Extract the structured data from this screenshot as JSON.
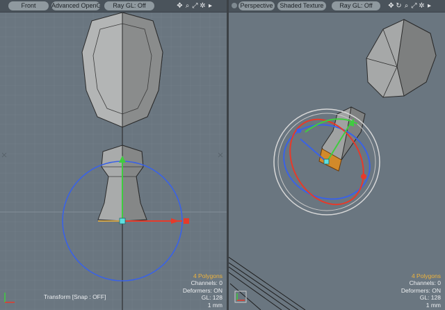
{
  "left_viewport": {
    "view_label": "Front",
    "shading_label": "Advanced OpenGL",
    "raygl_label": "Ray GL: Off",
    "stats": {
      "polygons": "4 Polygons",
      "channels": "Channels: 0",
      "deformers": "Deformers: ON",
      "gl": "GL: 128",
      "unit": "1 mm"
    },
    "status": "Transform [Snap : OFF]",
    "icons": [
      "move-view-icon",
      "zoom-view-icon",
      "fit-view-icon",
      "settings-icon",
      "menu-arrow-icon"
    ]
  },
  "right_viewport": {
    "view_label": "Perspective",
    "shading_label": "Shaded Texture",
    "raygl_label": "Ray GL: Off",
    "stats": {
      "polygons": "4 Polygons",
      "channels": "Channels: 0",
      "deformers": "Deformers: ON",
      "gl": "GL: 128",
      "unit": "1 mm"
    },
    "icons": [
      "move-view-icon",
      "rotate-view-icon",
      "zoom-view-icon",
      "fit-view-icon",
      "settings-icon",
      "menu-arrow-icon"
    ]
  },
  "colors": {
    "viewport_bg": "#6a7680",
    "grid_line": "#737f89",
    "header_bg": "#4a535b",
    "button_bg": "#8f999f",
    "polygon_count": "#f0b43b",
    "gizmo_x": "#e63a2a",
    "gizmo_y": "#3fcc3f",
    "gizmo_z": "#3a62e6"
  }
}
